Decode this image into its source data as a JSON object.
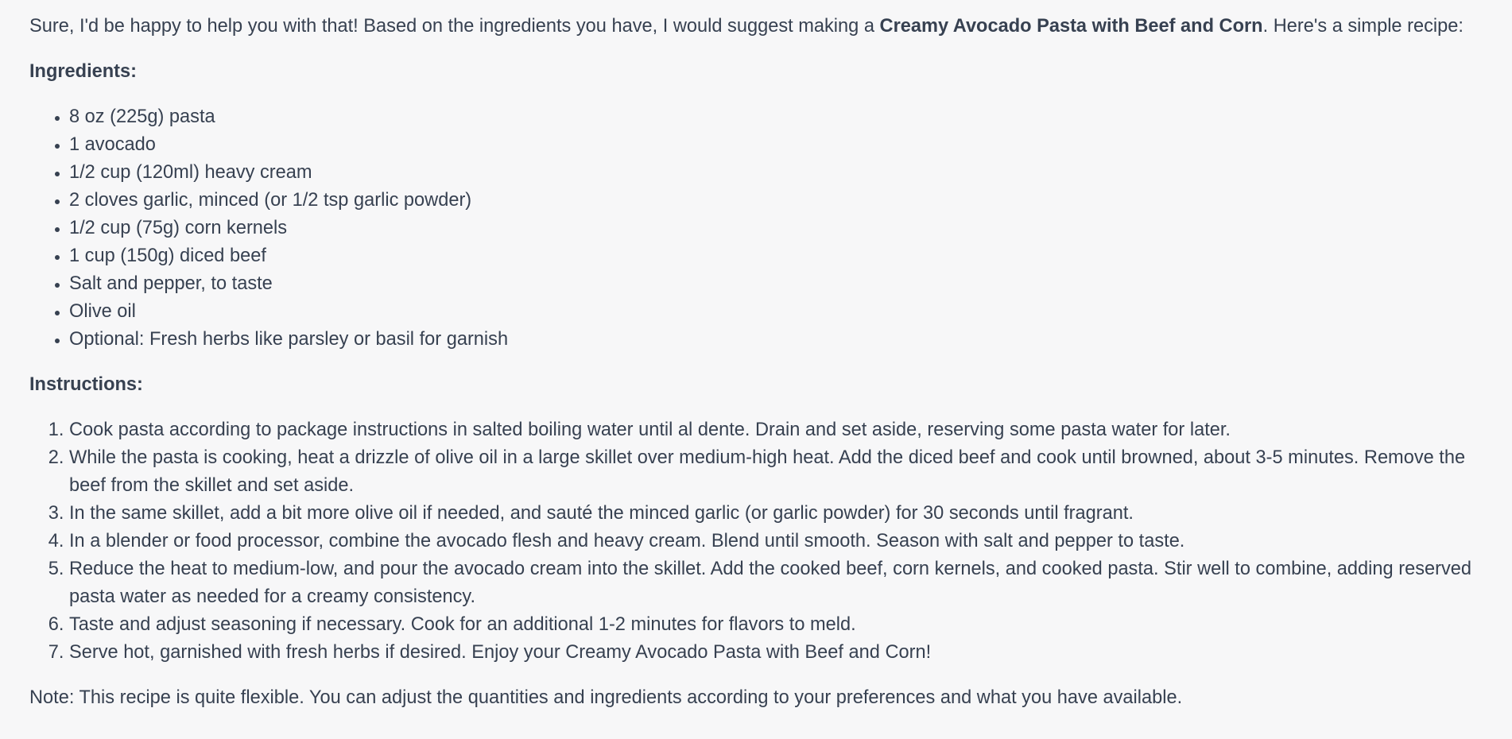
{
  "intro": {
    "prefix": "Sure, I'd be happy to help you with that! Based on the ingredients you have, I would suggest making a ",
    "dish_name": "Creamy Avocado Pasta with Beef and Corn",
    "suffix": ". Here's a simple recipe:"
  },
  "ingredients": {
    "heading": "Ingredients:",
    "items": [
      "8 oz (225g) pasta",
      "1 avocado",
      "1/2 cup (120ml) heavy cream",
      "2 cloves garlic, minced (or 1/2 tsp garlic powder)",
      "1/2 cup (75g) corn kernels",
      "1 cup (150g) diced beef",
      "Salt and pepper, to taste",
      "Olive oil",
      "Optional: Fresh herbs like parsley or basil for garnish"
    ]
  },
  "instructions": {
    "heading": "Instructions:",
    "steps": [
      "Cook pasta according to package instructions in salted boiling water until al dente. Drain and set aside, reserving some pasta water for later.",
      "While the pasta is cooking, heat a drizzle of olive oil in a large skillet over medium-high heat. Add the diced beef and cook until browned, about 3-5 minutes. Remove the beef from the skillet and set aside.",
      "In the same skillet, add a bit more olive oil if needed, and sauté the minced garlic (or garlic powder) for 30 seconds until fragrant.",
      "In a blender or food processor, combine the avocado flesh and heavy cream. Blend until smooth. Season with salt and pepper to taste.",
      "Reduce the heat to medium-low, and pour the avocado cream into the skillet. Add the cooked beef, corn kernels, and cooked pasta. Stir well to combine, adding reserved pasta water as needed for a creamy consistency.",
      "Taste and adjust seasoning if necessary. Cook for an additional 1-2 minutes for flavors to meld.",
      "Serve hot, garnished with fresh herbs if desired. Enjoy your Creamy Avocado Pasta with Beef and Corn!"
    ]
  },
  "note": "Note: This recipe is quite flexible. You can adjust the quantities and ingredients according to your preferences and what you have available.",
  "colors": {
    "background": "#f7f7f8",
    "text": "#374151"
  }
}
